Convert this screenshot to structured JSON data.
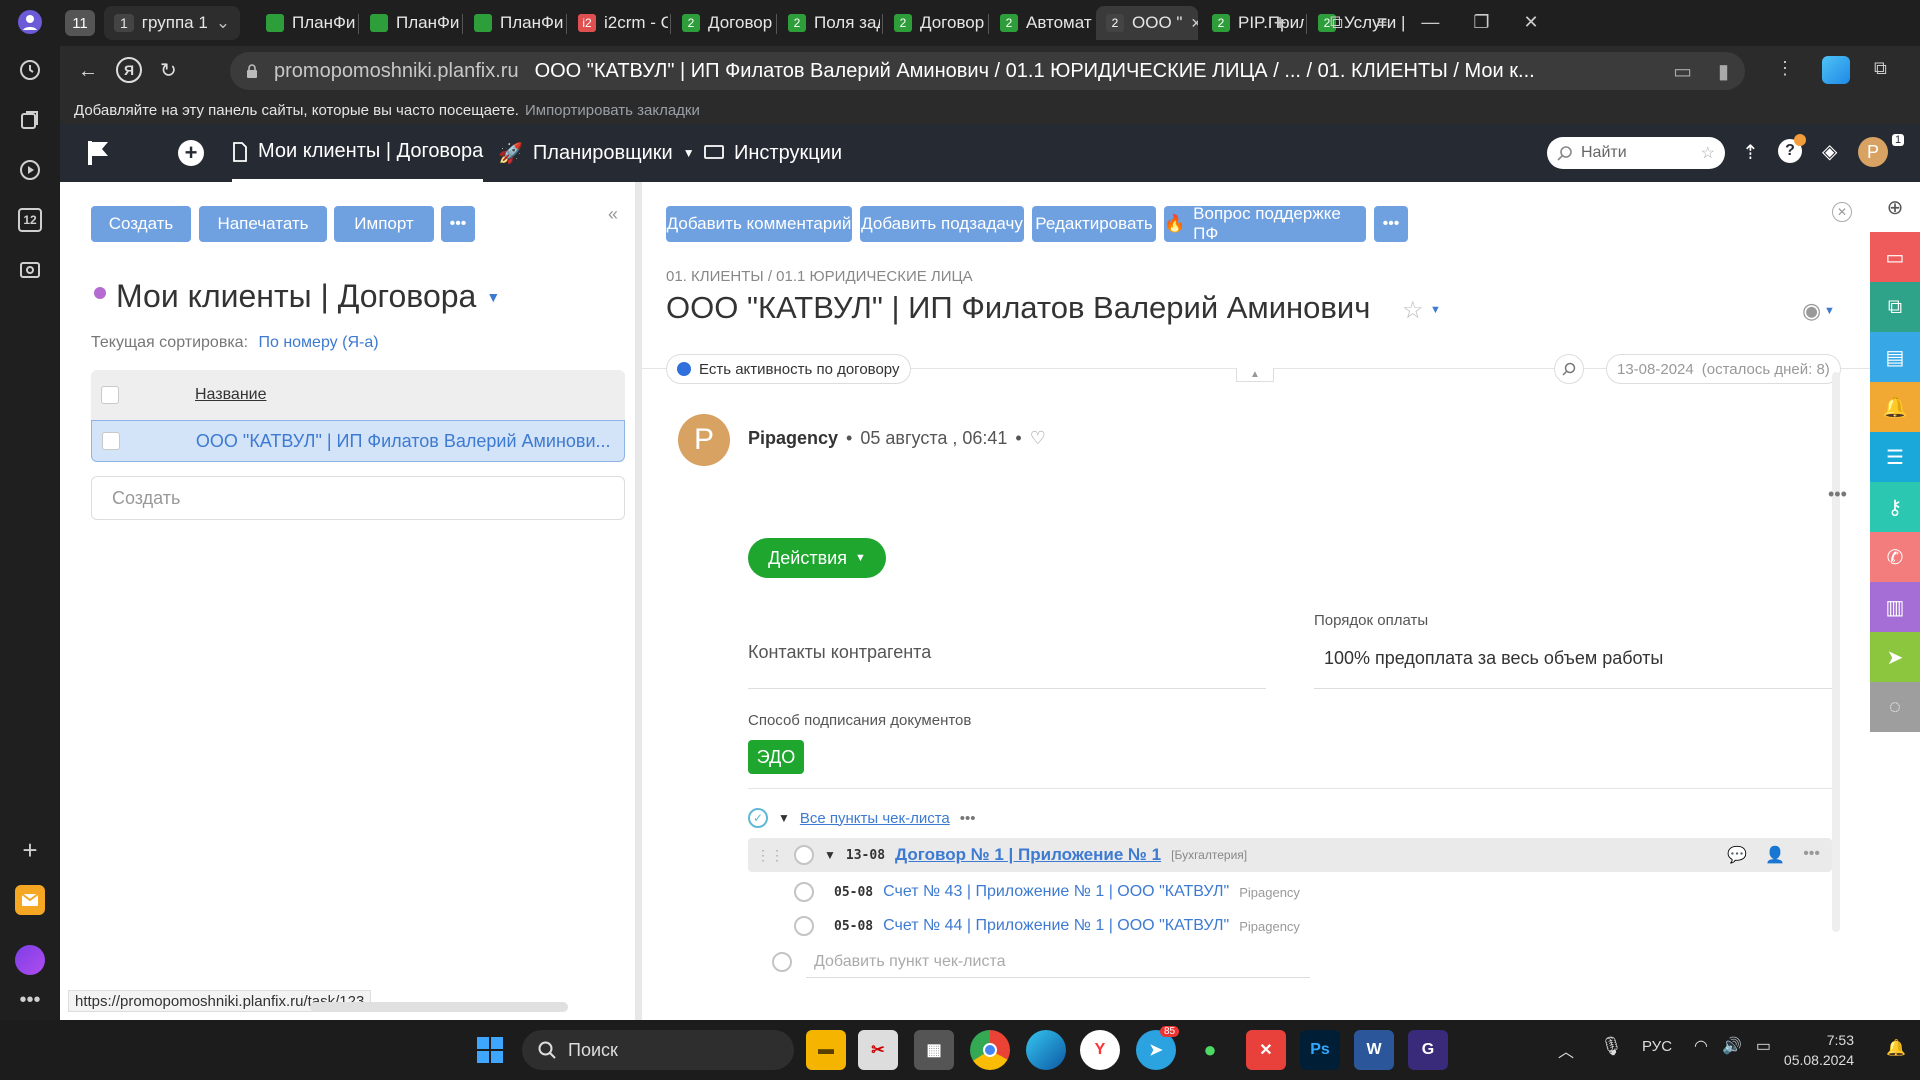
{
  "browser": {
    "tab_group_count": "11",
    "group": {
      "count": "1",
      "label": "группа 1"
    },
    "tabs": [
      {
        "label": "ПланФи",
        "badge": "",
        "color": "#2e9e3a"
      },
      {
        "label": "ПланФи",
        "badge": "",
        "color": "#2e9e3a"
      },
      {
        "label": "ПланФи",
        "badge": "",
        "color": "#2e9e3a"
      },
      {
        "label": "i2crm - C",
        "badge": "i2",
        "color": "#e05050"
      },
      {
        "label": "Договор",
        "badge": "2",
        "color": "#2e9e3a"
      },
      {
        "label": "Поля зад",
        "badge": "2",
        "color": "#2e9e3a"
      },
      {
        "label": "Договор",
        "badge": "2",
        "color": "#2e9e3a"
      },
      {
        "label": "Автомат",
        "badge": "2",
        "color": "#2e9e3a"
      },
      {
        "label": "ООО \"",
        "badge": "2",
        "color": "#444"
      },
      {
        "label": "PIP.Прил",
        "badge": "2",
        "color": "#2e9e3a"
      },
      {
        "label": "Услуги | ",
        "badge": "2",
        "color": "#2e9e3a"
      }
    ],
    "address_host": "promopomoshniki.planfix.ru",
    "address_title": "ООО \"КАТВУЛ\" | ИП Филатов Валерий Аминович / 01.1 ЮРИДИЧЕСКИЕ ЛИЦА / ... / 01. КЛИЕНТЫ / Мои к...",
    "bookmarks_hint": "Добавляйте на эту панель сайты, которые вы часто посещаете.",
    "bookmarks_import": "Импортировать закладки",
    "status_url": "https://promopomoshniki.planfix.ru/task/123"
  },
  "header": {
    "nav_current": "Мои клиенты | Договора",
    "nav_schedulers": "Планировщики",
    "nav_instructions": "Инструкции",
    "search_placeholder": "Найти",
    "notification_count": "1",
    "avatar_letter": "P"
  },
  "left": {
    "buttons": {
      "create": "Создать",
      "print": "Напечатать",
      "import": "Импорт"
    },
    "title": "Мои клиенты | Договора",
    "sort_label": "Текущая сортировка:",
    "sort_value": "По номеру (Я-а)",
    "column_name": "Название",
    "rows": [
      "ООО \"КАТВУЛ\" | ИП Филатов Валерий Аминови..."
    ],
    "create_placeholder": "Создать"
  },
  "main": {
    "buttons": {
      "comment": "Добавить комментарий",
      "subtask": "Добавить подзадачу",
      "edit": "Редактировать",
      "support": "Вопрос поддержке ПФ"
    },
    "breadcrumb": "01. КЛИЕНТЫ / 01.1 ЮРИДИЧЕСКИЕ ЛИЦА",
    "title": "ООО \"КАТВУЛ\" | ИП Филатов Валерий Аминович",
    "activity_label": "Есть активность по договору",
    "deadline": "13-08-2024",
    "deadline_left": "(осталось дней: 8)",
    "author": "Pipagency",
    "author_letter": "P",
    "date": "05 августа , 06:41",
    "actions_label": "Действия",
    "contacts_label": "Контакты контрагента",
    "payment_label": "Порядок оплаты",
    "payment_value": "100% предоплата за весь объем работы",
    "signing_label": "Способ подписания документов",
    "signing_value": "ЭДО",
    "checklist_all": "Все пункты чек-листа",
    "checklist": {
      "parent": {
        "date": "13-08",
        "title": "Договор № 1 | Приложение № 1",
        "tag": "[Бухгалтерия]"
      },
      "children": [
        {
          "date": "05-08",
          "title": "Счет № 43 | Приложение № 1 | ООО \"КАТВУЛ\"",
          "owner": "Pipagency"
        },
        {
          "date": "05-08",
          "title": "Счет № 44 | Приложение № 1 | ООО \"КАТВУЛ\"",
          "owner": "Pipagency"
        }
      ],
      "add_placeholder": "Добавить пункт чек-листа"
    }
  },
  "taskbar": {
    "search": "Поиск",
    "lang": "РУС",
    "time": "7:53",
    "date": "05.08.2024",
    "telegram_badge": "85"
  },
  "colors": {
    "accent_blue": "#6fa0e0",
    "green": "#1ea62f",
    "header_bg": "#262a33"
  }
}
